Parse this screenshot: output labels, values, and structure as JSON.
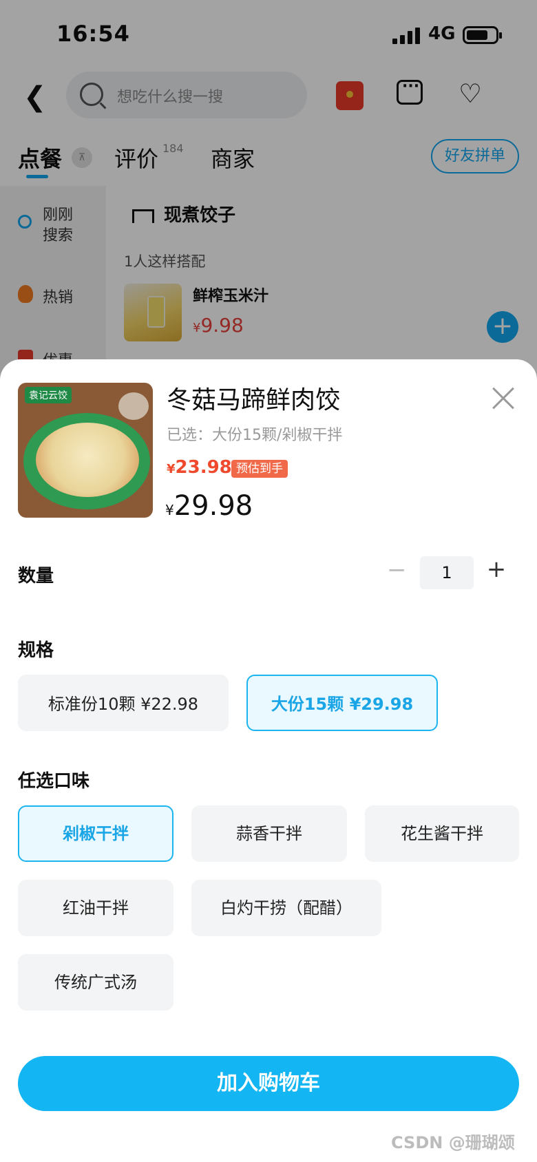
{
  "status": {
    "time": "16:54",
    "network": "4G"
  },
  "search": {
    "placeholder": "想吃什么搜一搜"
  },
  "tabs": {
    "order": "点餐",
    "review": "评价",
    "review_count": "184",
    "merchant": "商家",
    "group_order": "好友拼单"
  },
  "sidebar": {
    "recent": "刚刚搜索",
    "hot": "热销",
    "promo": "优惠"
  },
  "menu": {
    "section_title": "现煮饺子",
    "combo_note": "1人这样搭配",
    "combo_item": {
      "name": "鲜榨玉米汁",
      "currency": "¥",
      "price": "9.98"
    }
  },
  "product": {
    "title": "冬菇马蹄鲜肉饺",
    "selected": "已选：大份15颗/剁椒干拌",
    "est_currency": "¥",
    "est_price": "23.98",
    "est_badge": "预估到手",
    "currency": "¥",
    "price": "29.98",
    "brand": "袁记云饺"
  },
  "quantity": {
    "label": "数量",
    "value": "1",
    "minus": "−",
    "plus": "+"
  },
  "spec": {
    "label": "规格",
    "options": [
      {
        "label": "标准份10颗  ¥22.98",
        "selected": false
      },
      {
        "label": "大份15颗  ¥29.98",
        "selected": true
      }
    ]
  },
  "flavor": {
    "label": "任选口味",
    "options": [
      {
        "label": "剁椒干拌",
        "selected": true
      },
      {
        "label": "蒜香干拌",
        "selected": false
      },
      {
        "label": "花生酱干拌",
        "selected": false
      },
      {
        "label": "红油干拌",
        "selected": false
      },
      {
        "label": "白灼干捞（配醋）",
        "selected": false
      },
      {
        "label": "传统广式汤",
        "selected": false
      }
    ]
  },
  "cart": {
    "add_label": "加入购物车"
  },
  "watermark": "CSDN @珊瑚颂",
  "colors": {
    "accent": "#13b5f3",
    "price_red": "#f04a2e"
  }
}
